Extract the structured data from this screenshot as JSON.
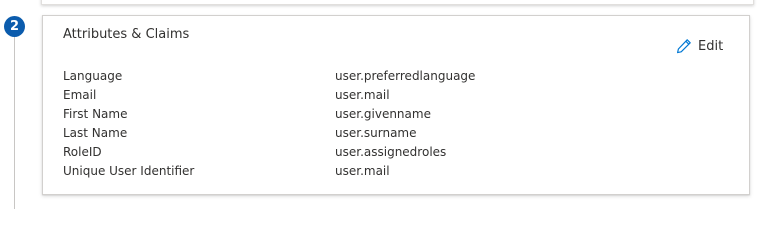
{
  "step": {
    "number": "2"
  },
  "card": {
    "title": "Attributes & Claims",
    "edit_label": "Edit",
    "edit_icon": "pencil-icon",
    "accent_color": "#0b5cad",
    "icon_color": "#0078d4"
  },
  "claims": [
    {
      "name": "Language",
      "value": "user.preferredlanguage"
    },
    {
      "name": "Email",
      "value": "user.mail"
    },
    {
      "name": "First Name",
      "value": "user.givenname"
    },
    {
      "name": "Last Name",
      "value": "user.surname"
    },
    {
      "name": "RoleID",
      "value": "user.assignedroles"
    },
    {
      "name": "Unique User Identifier",
      "value": "user.mail"
    }
  ]
}
